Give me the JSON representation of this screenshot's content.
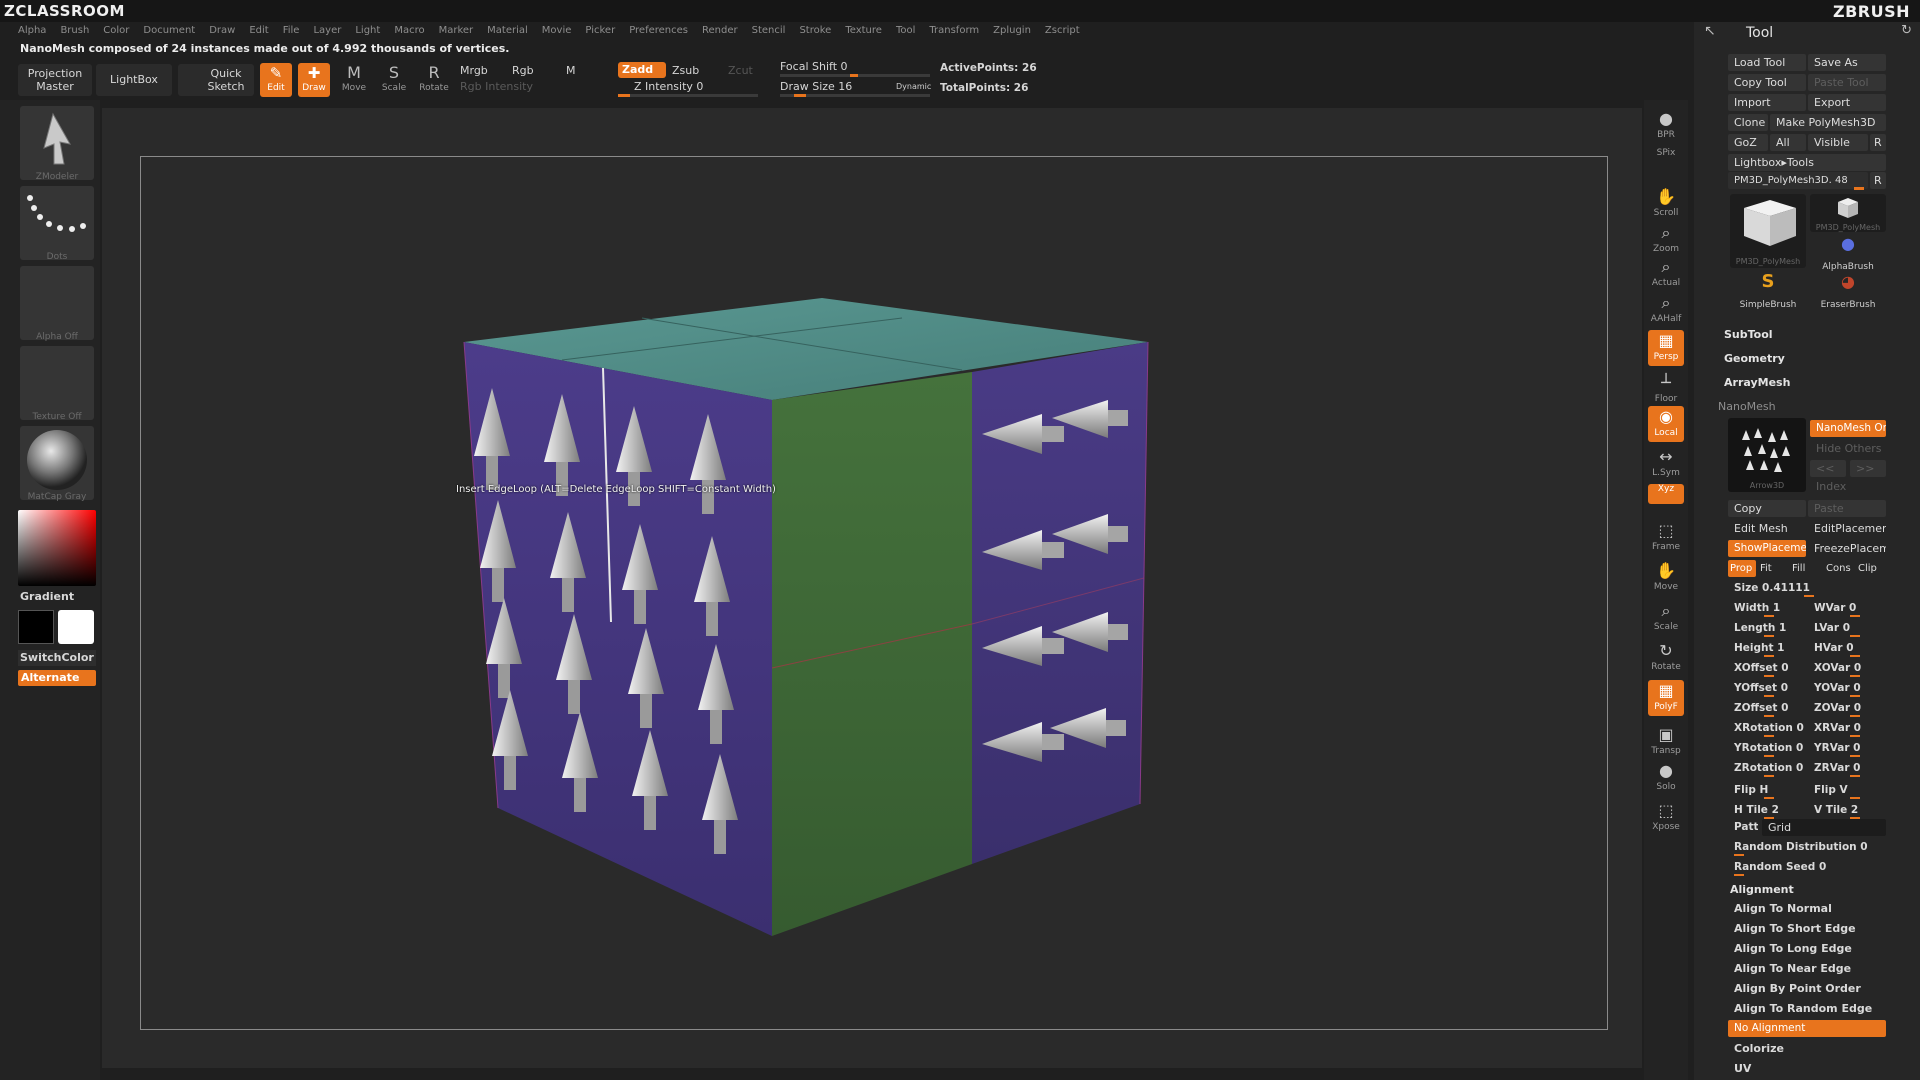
{
  "brand": {
    "left": "ZCLASSROOM",
    "right": "ZBRUSH"
  },
  "menu": [
    "Alpha",
    "Brush",
    "Color",
    "Document",
    "Draw",
    "Edit",
    "File",
    "Layer",
    "Light",
    "Macro",
    "Marker",
    "Material",
    "Movie",
    "Picker",
    "Preferences",
    "Render",
    "Stencil",
    "Stroke",
    "Texture",
    "Tool",
    "Transform",
    "Zplugin",
    "Zscript"
  ],
  "notice": "NanoMesh composed of 24 instances made out of 4.992 thousands of vertices.",
  "toprow": {
    "projection_master": "Projection Master",
    "lightbox": "LightBox",
    "quick_sketch": "Quick Sketch",
    "edit": "Edit",
    "draw": "Draw",
    "move": "Move",
    "scale": "Scale",
    "rotate": "Rotate",
    "mrgb": "Mrgb",
    "rgb": "Rgb",
    "m": "M",
    "rgb_intensity": "Rgb Intensity",
    "zadd": "Zadd",
    "zsub": "Zsub",
    "zcut": "Zcut",
    "z_intensity": "Z Intensity 0",
    "focal_shift": "Focal Shift 0",
    "draw_size": "Draw Size 16",
    "dynamic": "Dynamic",
    "active_points": "ActivePoints: 26",
    "total_points": "TotalPoints: 26"
  },
  "leftshelf": {
    "brush_label": "ZModeler",
    "stroke_label": "Dots",
    "alpha_label": "Alpha  Off",
    "texture_label": "Texture  Off",
    "material_label": "MatCap  Gray",
    "gradient": "Gradient",
    "switchcolor": "SwitchColor",
    "alternate": "Alternate"
  },
  "tooltip": "Insert EdgeLoop (ALT=Delete EdgeLoop SHIFT=Constant Width)",
  "rtoolbar": [
    {
      "label": "BPR",
      "icon": "bpr-icon"
    },
    {
      "label": "SPix",
      "icon": "spix-icon"
    },
    {
      "label": "Scroll",
      "icon": "scroll-icon"
    },
    {
      "label": "Zoom",
      "icon": "zoom-icon"
    },
    {
      "label": "Actual",
      "icon": "actual-icon"
    },
    {
      "label": "AAHalf",
      "icon": "aahalf-icon"
    },
    {
      "label": "Persp",
      "icon": "persp-icon"
    },
    {
      "label": "Floor",
      "icon": "floor-icon"
    },
    {
      "label": "Local",
      "icon": "local-icon"
    },
    {
      "label": "L.Sym",
      "icon": "lsym-icon"
    },
    {
      "label": "Xyz",
      "icon": "xyz-icon"
    },
    {
      "label": "Frame",
      "icon": "frame-icon"
    },
    {
      "label": "Move",
      "icon": "move-icon"
    },
    {
      "label": "Scale",
      "icon": "scale-icon"
    },
    {
      "label": "Rotate",
      "icon": "rotate-icon"
    },
    {
      "label": "PolyF",
      "icon": "polyf-icon"
    },
    {
      "label": "Transp",
      "icon": "transp-icon"
    },
    {
      "label": "Solo",
      "icon": "solo-icon"
    },
    {
      "label": "Xpose",
      "icon": "xpose-icon"
    }
  ],
  "tool": {
    "title": "Tool",
    "load_tool": "Load Tool",
    "save_as": "Save As",
    "copy_tool": "Copy Tool",
    "paste_tool": "Paste Tool",
    "import": "Import",
    "export": "Export",
    "clone": "Clone",
    "make_polymesh": "Make PolyMesh3D",
    "goz": "GoZ",
    "all": "All",
    "visible": "Visible",
    "r": "R",
    "lightbox_tools": "Lightbox▸Tools",
    "current_tool": "PM3D_PolyMesh3D. 48",
    "thumbs": [
      "PM3D_PolyMesh",
      "PM3D_PolyMesh",
      "AlphaBrush",
      "SimpleBrush",
      "EraserBrush"
    ],
    "subtool": "SubTool",
    "geometry": "Geometry",
    "arraymesh": "ArrayMesh",
    "nanomesh": "NanoMesh",
    "nanomesh_on": "NanoMesh On",
    "hide_others": "Hide Others",
    "nav_prev": "<<",
    "nav_next": ">>",
    "index": "Index",
    "nano_thumb": "Arrow3D",
    "copy": "Copy",
    "paste": "Paste",
    "edit_mesh": "Edit Mesh",
    "edit_placement": "EditPlacement",
    "show_placement": "ShowPlacement",
    "freeze_placement": "FreezePlacement",
    "prop": "Prop",
    "fit": "Fit",
    "fill": "Fill",
    "cons": "Cons",
    "clip": "Clip",
    "size": "Size 0.41111",
    "rows": [
      [
        "Width 1",
        "WVar 0"
      ],
      [
        "Length 1",
        "LVar 0"
      ],
      [
        "Height 1",
        "HVar 0"
      ],
      [
        "XOffset 0",
        "XOVar 0"
      ],
      [
        "YOffset 0",
        "YOVar 0"
      ],
      [
        "ZOffset 0",
        "ZOVar 0"
      ],
      [
        "XRotation 0",
        "XRVar 0"
      ],
      [
        "YRotation 0",
        "YRVar 0"
      ],
      [
        "ZRotation 0",
        "ZRVar 0"
      ],
      [
        "Flip H",
        "Flip V"
      ],
      [
        "H Tile 2",
        "V Tile 2"
      ]
    ],
    "pattern": "Pattern",
    "pattern_value": "Grid",
    "random_distribution": "Random Distribution 0",
    "random_seed": "Random Seed 0",
    "alignment": "Alignment",
    "align_items": [
      "Align To Normal",
      "Align To Short Edge",
      "Align To Long Edge",
      "Align To Near Edge",
      "Align By Point Order",
      "Align To Random Edge"
    ],
    "no_alignment": "No Alignment",
    "colorize": "Colorize",
    "uv": "UV"
  },
  "colors": {
    "accent": "#e8741d",
    "cube_top": "#4f8b86",
    "cube_left": "#4b3a86",
    "cube_right_green": "#3f6a37"
  }
}
